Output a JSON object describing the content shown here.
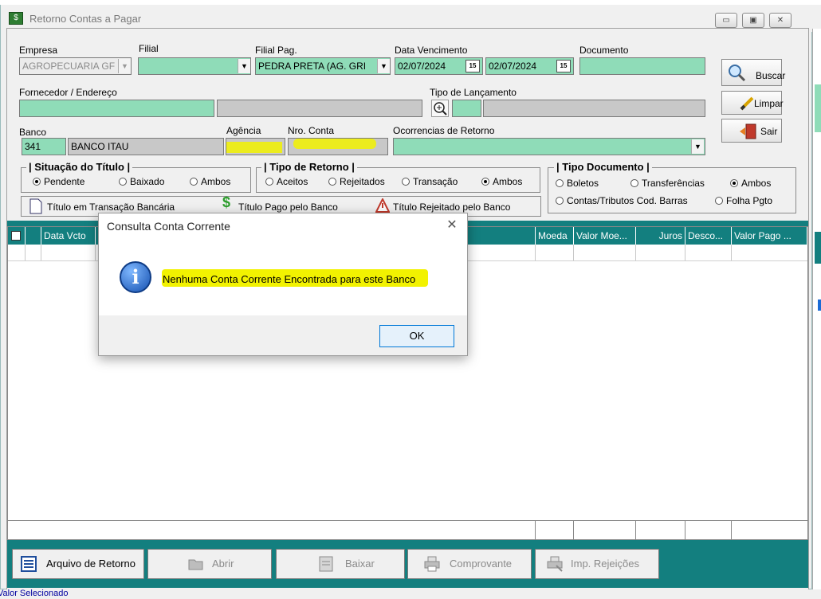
{
  "window": {
    "title": "Retorno Contas a Pagar",
    "icon": "money-icon",
    "min_label": "▭",
    "max_label": "▣",
    "close_label": "✕"
  },
  "filters": {
    "empresa": {
      "label": "Empresa",
      "value": "AGROPECUARIA GF"
    },
    "filial": {
      "label": "Filial",
      "value": ""
    },
    "filial_pag": {
      "label": "Filial Pag.",
      "value": "PEDRA PRETA (AG. GRI"
    },
    "data_vencimento": {
      "label": "Data Vencimento",
      "from": "02/07/2024",
      "to": "02/07/2024",
      "cal_icon": "15"
    },
    "documento": {
      "label": "Documento",
      "value": ""
    },
    "fornecedor": {
      "label": "Fornecedor / Endereço",
      "value": "",
      "endereco": ""
    },
    "tipo_lancamento": {
      "label": "Tipo de Lançamento",
      "code": "",
      "desc": ""
    },
    "banco": {
      "label": "Banco",
      "code": "341",
      "name": "BANCO ITAU"
    },
    "agencia": {
      "label": "Agência",
      "value": ""
    },
    "conta": {
      "label": "Nro. Conta",
      "value": ""
    },
    "ocorrencias": {
      "label": "Ocorrencias de Retorno",
      "value": ""
    }
  },
  "side_buttons": {
    "buscar": "Buscar",
    "limpar": "Limpar",
    "sair": "Sair"
  },
  "situacao": {
    "title": "| Situação do Título |",
    "options": [
      "Pendente",
      "Baixado",
      "Ambos"
    ],
    "selected": "Pendente"
  },
  "tipo_retorno": {
    "title": "| Tipo de Retorno |",
    "options": [
      "Aceitos",
      "Rejeitados",
      "Transação",
      "Ambos"
    ],
    "selected": "Ambos"
  },
  "tipo_documento": {
    "title": "| Tipo Documento |",
    "options": [
      "Boletos",
      "Transferências",
      "Ambos",
      "Contas/Tributos Cod. Barras",
      "Folha Pgto"
    ],
    "selected": "Ambos"
  },
  "legend": {
    "transacao": "Título em Transação Bancária",
    "pago": "Título Pago pelo Banco",
    "rejeitado": "Título Rejeitado pelo Banco"
  },
  "grid": {
    "columns": [
      "",
      "Data Vcto",
      "",
      "Moeda",
      "Valor Moe...",
      "Juros",
      "Desco...",
      "Valor Pago ..."
    ]
  },
  "bottom_buttons": {
    "arquivo": "Arquivo de Retorno",
    "abrir": "Abrir",
    "baixar": "Baixar",
    "comprovante": "Comprovante",
    "rejeicoes": "Imp. Rejeições"
  },
  "status": {
    "text": "Valor Selecionado"
  },
  "dialog": {
    "title": "Consulta Conta Corrente",
    "message": "Nenhuma Conta Corrente Encontrada para este Banco",
    "ok": "OK",
    "close": "✕",
    "info_icon": "i"
  },
  "colors": {
    "teal": "#137f7f",
    "field_green": "#8fdcb8",
    "highlight": "#f2f200"
  }
}
